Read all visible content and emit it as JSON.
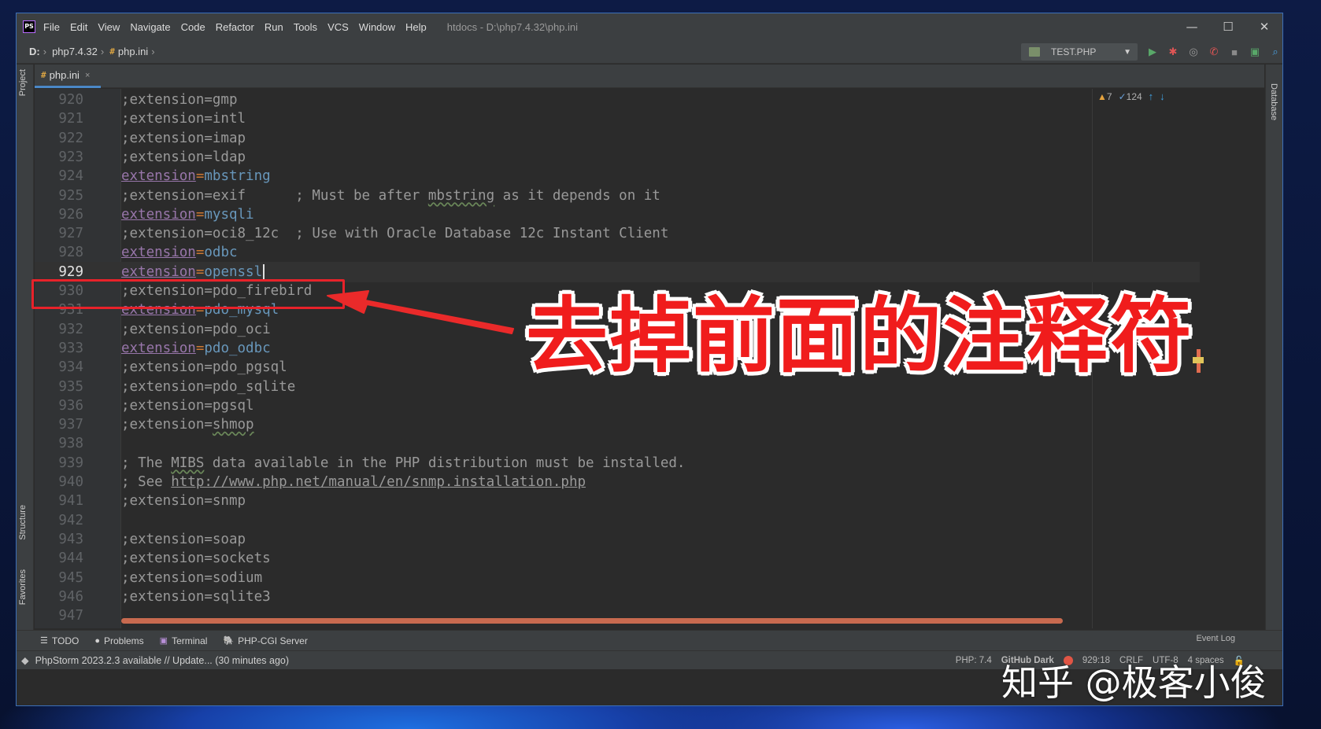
{
  "app": {
    "logo": "PS",
    "menu": [
      "File",
      "Edit",
      "View",
      "Navigate",
      "Code",
      "Refactor",
      "Run",
      "Tools",
      "VCS",
      "Window",
      "Help"
    ],
    "window_title": "htdocs - D:\\php7.4.32\\php.ini",
    "controls": [
      "—",
      "☐",
      "✕"
    ]
  },
  "navbar": {
    "crumbs": [
      "D:",
      "php7.4.32",
      "php.ini"
    ],
    "ini_icon": "#",
    "run_config": "TEST.PHP"
  },
  "left_tabs": [
    "Project",
    "Structure",
    "Favorites"
  ],
  "right_tabs": [
    "Database"
  ],
  "editor_tab": {
    "label": "php.ini",
    "close": "×"
  },
  "inspections": {
    "warnings": "7",
    "typos": "124"
  },
  "lines": [
    {
      "n": "920",
      "text": ";extension=gmp"
    },
    {
      "n": "921",
      "text": ";extension=intl"
    },
    {
      "n": "922",
      "text": ";extension=imap"
    },
    {
      "n": "923",
      "text": ";extension=ldap"
    },
    {
      "n": "924",
      "key": "extension",
      "val": "mbstring"
    },
    {
      "n": "925",
      "pre": ";extension=exif      ; Must be after ",
      "typo": "mbstring",
      "post": " as it depends on it"
    },
    {
      "n": "926",
      "key": "extension",
      "val": "mysqli"
    },
    {
      "n": "927",
      "text": ";extension=oci8_12c  ; Use with Oracle Database 12c Instant Client"
    },
    {
      "n": "928",
      "key": "extension",
      "val": "odbc"
    },
    {
      "n": "929",
      "key": "extension",
      "val": "openssl",
      "current": true
    },
    {
      "n": "930",
      "text": ";extension=pdo_firebird"
    },
    {
      "n": "931",
      "key": "extension",
      "val": "pdo_mysql"
    },
    {
      "n": "932",
      "text": ";extension=pdo_oci"
    },
    {
      "n": "933",
      "key": "extension",
      "val": "pdo_odbc"
    },
    {
      "n": "934",
      "text": ";extension=pdo_pgsql"
    },
    {
      "n": "935",
      "text": ";extension=pdo_sqlite"
    },
    {
      "n": "936",
      "text": ";extension=pgsql"
    },
    {
      "n": "937",
      "pre": ";extension=",
      "typo": "shmop",
      "post": ""
    },
    {
      "n": "938",
      "text": ""
    },
    {
      "n": "939",
      "pre": "; The ",
      "typo": "MIBS",
      "post": " data available in the PHP distribution must be installed."
    },
    {
      "n": "940",
      "pre": "; See ",
      "link": "http://www.php.net/manual/en/snmp.installation.php",
      "post": ""
    },
    {
      "n": "941",
      "text": ";extension=snmp"
    },
    {
      "n": "942",
      "text": ""
    },
    {
      "n": "943",
      "text": ";extension=soap"
    },
    {
      "n": "944",
      "text": ";extension=sockets"
    },
    {
      "n": "945",
      "text": ";extension=sodium"
    },
    {
      "n": "946",
      "text": ";extension=sqlite3"
    },
    {
      "n": "947",
      "text": ""
    }
  ],
  "bottom_tabs": [
    {
      "icon": "☰",
      "label": "TODO"
    },
    {
      "icon": "●",
      "label": "Problems"
    },
    {
      "icon": "▣",
      "label": "Terminal"
    },
    {
      "icon": "🐘",
      "label": "PHP-CGI Server"
    }
  ],
  "status": {
    "message": "PhpStorm 2023.2.3 available // Update... (30 minutes ago)",
    "event_log": "Event Log",
    "php": "PHP: 7.4",
    "theme": "GitHub Dark",
    "position": "929:18",
    "line_sep": "CRLF",
    "encoding": "UTF-8",
    "indent": "4 spaces"
  },
  "annotation": {
    "text": "去掉前面的注释符",
    "watermark": "知乎 @极客小俊",
    "color": "#f01c1c"
  }
}
